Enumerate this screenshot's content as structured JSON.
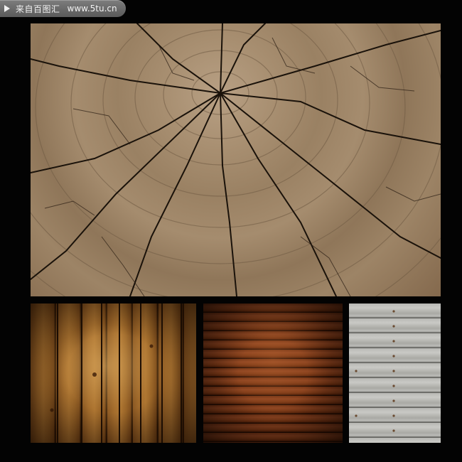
{
  "watermark": {
    "site_name": "来自百图汇",
    "url": "www.5tu.cn",
    "icon": "play-arrow-icon"
  },
  "tiles": [
    {
      "name": "tree-stump-rings-photo",
      "subject": "cracked tree stump cross-section"
    },
    {
      "name": "vertical-wood-planks-photo",
      "subject": "warm vertical wood planks"
    },
    {
      "name": "horizontal-wood-planks-photo",
      "subject": "dark reddish horizontal wood planks"
    },
    {
      "name": "grey-weathered-planks-photo",
      "subject": "grey weathered horizontal planks with nails"
    }
  ],
  "colors": {
    "background": "#030303",
    "watermark_bg": "#6b6b6b",
    "watermark_text": "#f2f2f2"
  }
}
